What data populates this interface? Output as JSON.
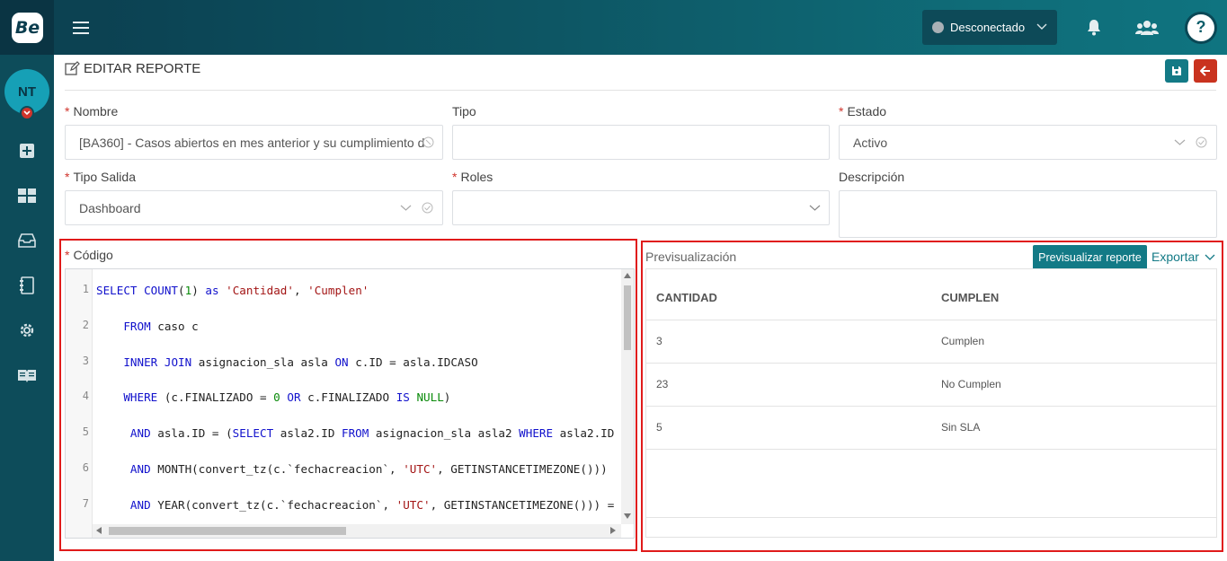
{
  "topbar": {
    "logo_text": "Be",
    "status_label": "Desconectado",
    "status_color": "#a9b1b6",
    "help_glyph": "?"
  },
  "sidebar": {
    "avatar_initials": "NT",
    "icons": [
      "plus-square-icon",
      "dashboard-icon",
      "inbox-icon",
      "notebook-icon",
      "gear-icon",
      "book-icon"
    ]
  },
  "page": {
    "title": "EDITAR REPORTE"
  },
  "form": {
    "nombre_label": "Nombre",
    "nombre_value": "[BA360] - Casos abiertos en mes anterior y su cumplimiento d",
    "tipo_label": "Tipo",
    "tipo_value": "",
    "estado_label": "Estado",
    "estado_value": "Activo",
    "tipo_salida_label": "Tipo Salida",
    "tipo_salida_value": "Dashboard",
    "roles_label": "Roles",
    "roles_value": "",
    "descripcion_label": "Descripción",
    "descripcion_value": "",
    "codigo_label": "Código",
    "required_mark": "*"
  },
  "code": {
    "lines": [
      {
        "n": "1",
        "text": "SELECT COUNT(1) as 'Cantidad', 'Cumplen'"
      },
      {
        "n": "2",
        "text": "    FROM caso c"
      },
      {
        "n": "3",
        "text": "    INNER JOIN asignacion_sla asla ON c.ID = asla.IDCASO"
      },
      {
        "n": "4",
        "text": "    WHERE (c.FINALIZADO = 0 OR c.FINALIZADO IS NULL)"
      },
      {
        "n": "5",
        "text": "     AND asla.ID = (SELECT asla2.ID FROM asignacion_sla asla2 WHERE asla2.ID"
      },
      {
        "n": "6",
        "text": "     AND MONTH(convert_tz(c.`fechacreacion`, 'UTC', GETINSTANCETIMEZONE()))"
      },
      {
        "n": "7",
        "text": "     AND YEAR(convert_tz(c.`fechacreacion`, 'UTC', GETINSTANCETIMEZONE())) ="
      }
    ]
  },
  "preview": {
    "title": "Previsualización",
    "button_label": "Previsualizar reporte",
    "export_label": "Exportar",
    "columns": [
      "CANTIDAD",
      "CUMPLEN"
    ],
    "rows": [
      [
        "3",
        "Cumplen"
      ],
      [
        "23",
        "No Cumplen"
      ],
      [
        "5",
        "Sin SLA"
      ]
    ]
  }
}
